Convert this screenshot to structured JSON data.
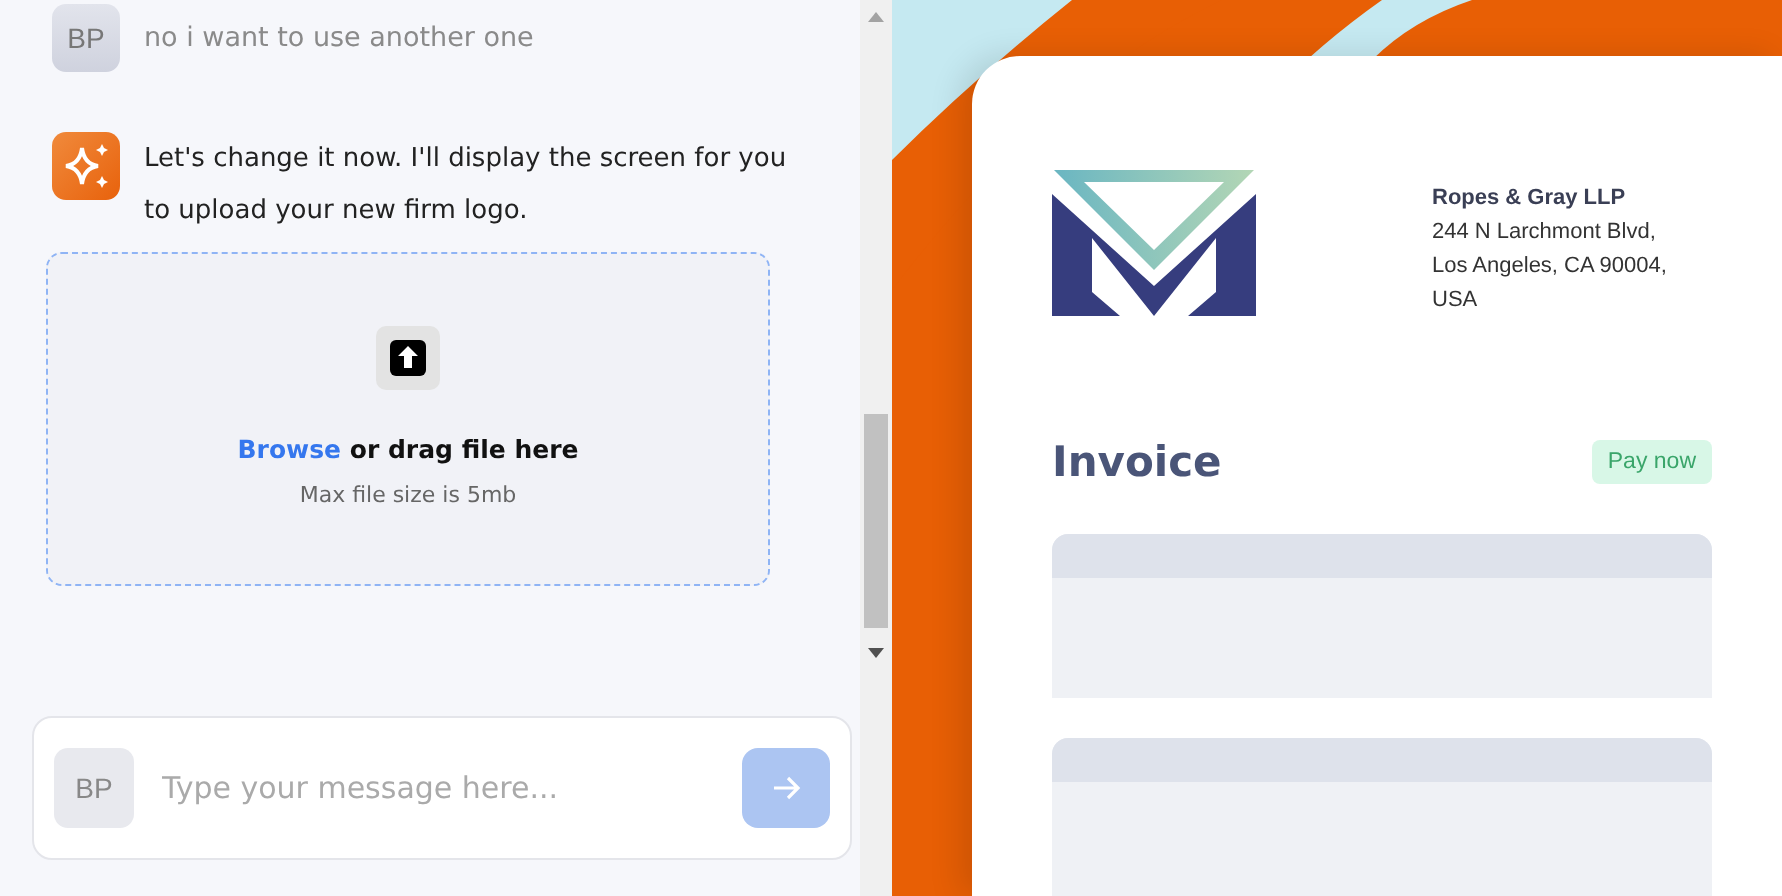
{
  "messages": [
    {
      "kind": "user",
      "avatar": "BP",
      "text": "no i want to use another one"
    },
    {
      "kind": "assistant",
      "text": "Let's change it now. I'll display the screen for you to upload your new firm logo."
    }
  ],
  "upload": {
    "link": "Browse",
    "text": "or drag file here",
    "hint": "Max file size is 5mb"
  },
  "composer": {
    "avatar": "BP",
    "placeholder": "Type your message here..."
  },
  "invoice": {
    "firm": "Ropes & Gray LLP",
    "address": [
      "244 N Larchmont Blvd,",
      "Los Angeles, CA 90004,",
      "USA"
    ],
    "title": "Invoice",
    "pay_button": "Pay now"
  }
}
